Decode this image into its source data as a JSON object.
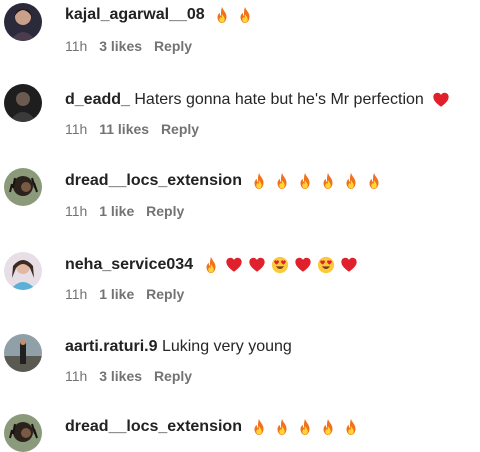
{
  "comments": [
    {
      "username": "kajal_agarwal__08",
      "text": "",
      "emojis": [
        "fire",
        "fire"
      ],
      "time": "11h",
      "likes": "3 likes",
      "reply": "Reply"
    },
    {
      "username": "d_eadd_",
      "text": "Haters gonna hate but he's Mr perfection",
      "emojis": [
        "heart"
      ],
      "time": "11h",
      "likes": "11 likes",
      "reply": "Reply"
    },
    {
      "username": "dread__locs_extension",
      "text": "",
      "emojis": [
        "fire",
        "fire",
        "fire",
        "fire",
        "fire",
        "fire"
      ],
      "time": "11h",
      "likes": "1 like",
      "reply": "Reply"
    },
    {
      "username": "neha_service034",
      "text": "",
      "emojis": [
        "fire",
        "heart",
        "heart",
        "heart-eyes",
        "heart",
        "heart-eyes",
        "heart"
      ],
      "time": "11h",
      "likes": "1 like",
      "reply": "Reply"
    },
    {
      "username": "aarti.raturi.9",
      "text": "Luking very young",
      "emojis": [],
      "time": "11h",
      "likes": "3 likes",
      "reply": "Reply"
    },
    {
      "username": "dread__locs_extension",
      "text": "",
      "emojis": [
        "fire",
        "fire",
        "fire",
        "fire",
        "fire"
      ],
      "time": "",
      "likes": "",
      "reply": ""
    }
  ]
}
